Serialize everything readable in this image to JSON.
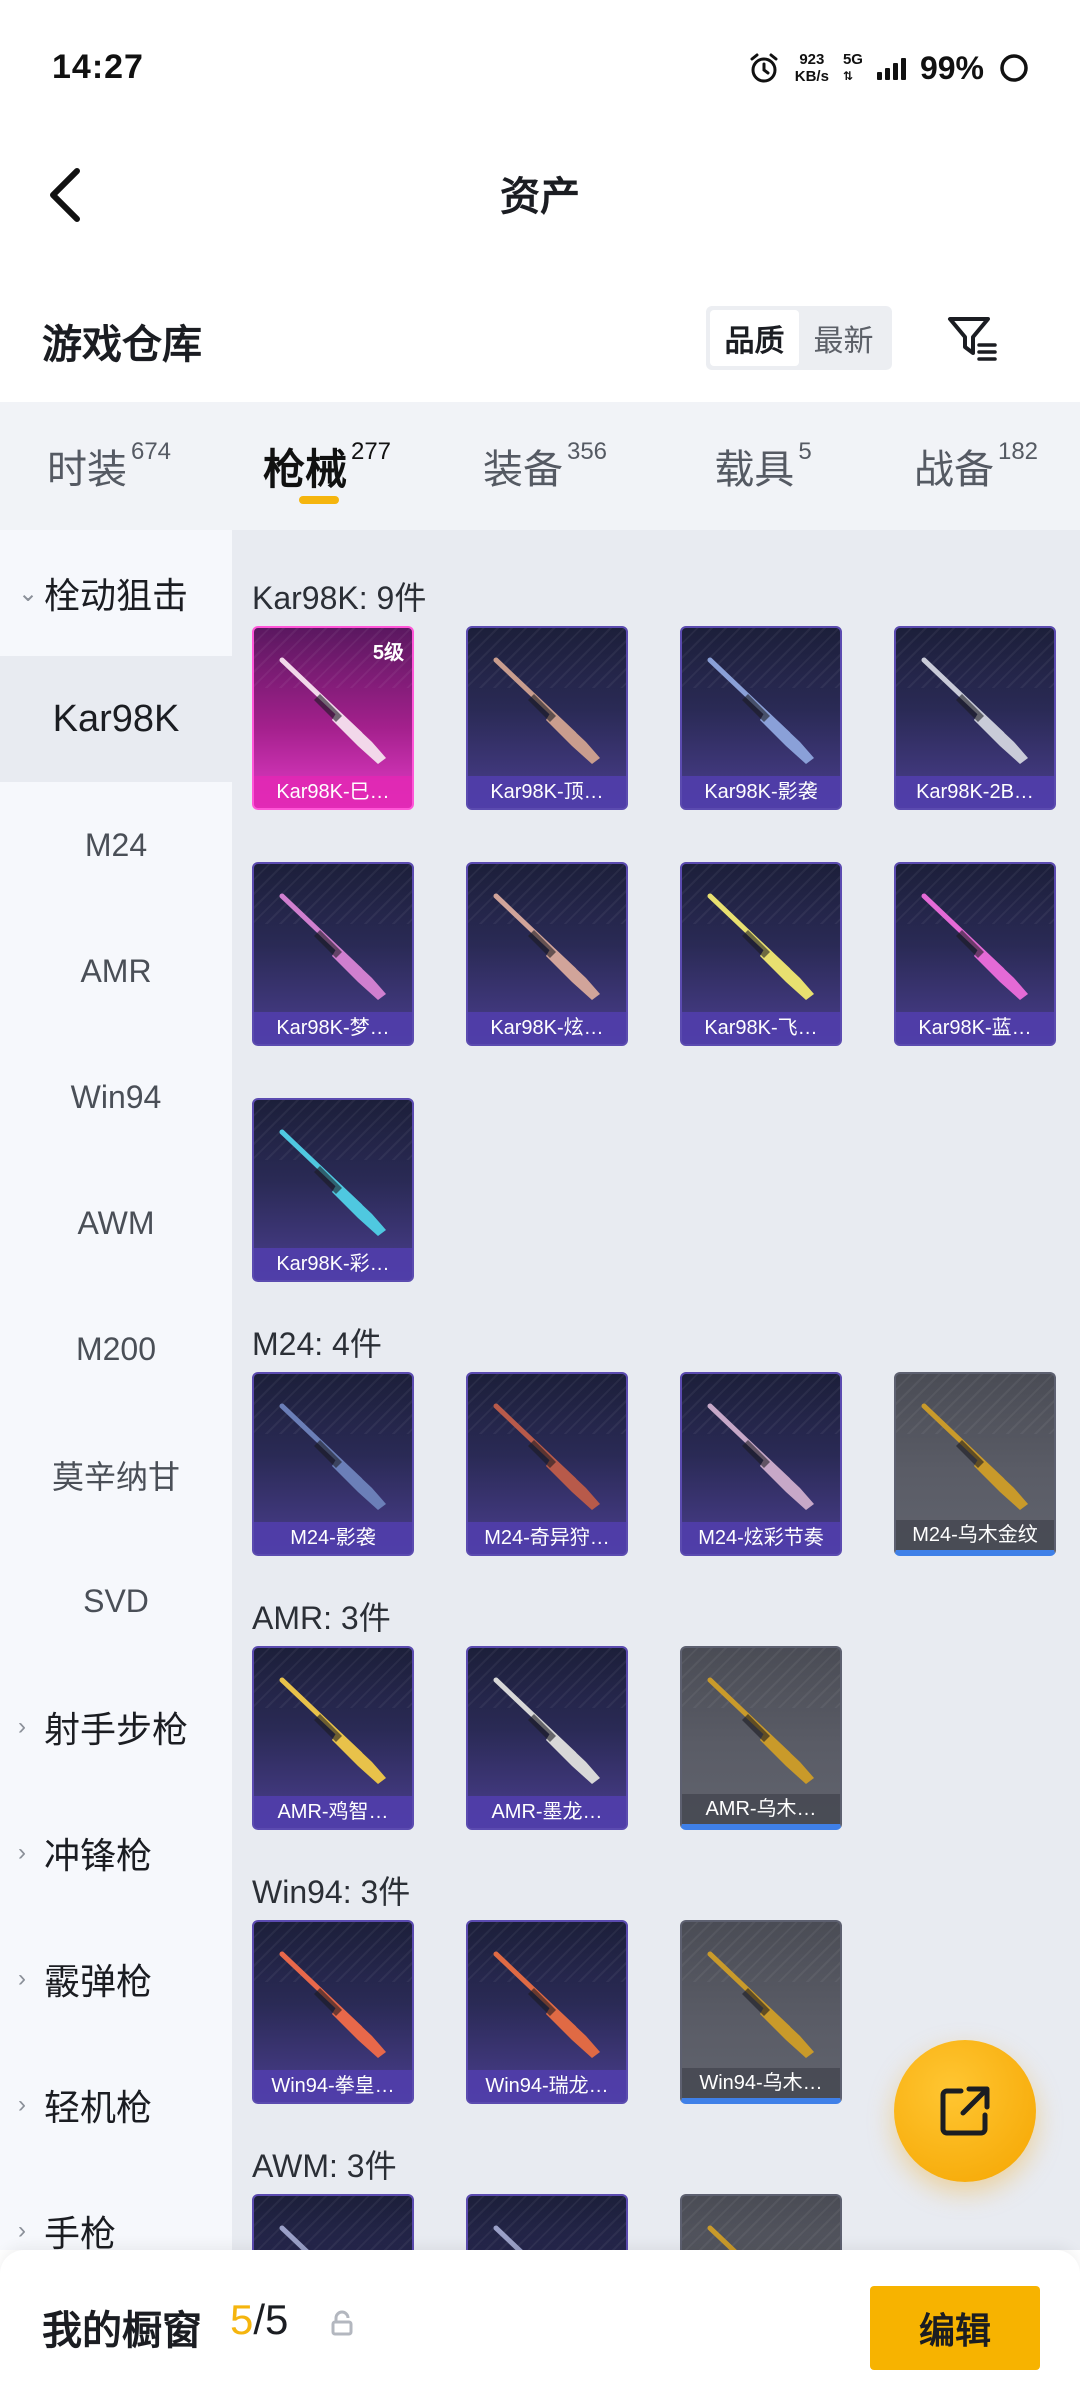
{
  "status_bar": {
    "time": "14:27",
    "speed_value": "923",
    "speed_unit": "KB/s",
    "network": "5G",
    "battery": "99%"
  },
  "header": {
    "title": "资产"
  },
  "warehouse": {
    "title": "游戏仓库",
    "sort_options": [
      "品质",
      "最新"
    ],
    "sort_selected": "品质"
  },
  "tabs": [
    {
      "label": "时装",
      "count": "674"
    },
    {
      "label": "枪械",
      "count": "277",
      "active": true
    },
    {
      "label": "装备",
      "count": "356"
    },
    {
      "label": "载具",
      "count": "5"
    },
    {
      "label": "战备",
      "count": "182"
    }
  ],
  "sidebar": {
    "groups": [
      {
        "label": "栓动狙击",
        "expanded": true,
        "items": [
          "Kar98K",
          "M24",
          "AMR",
          "Win94",
          "AWM",
          "M200",
          "莫辛纳甘",
          "SVD"
        ],
        "selected": "Kar98K"
      },
      {
        "label": "射手步枪"
      },
      {
        "label": "冲锋枪"
      },
      {
        "label": "霰弹枪"
      },
      {
        "label": "轻机枪"
      },
      {
        "label": "手枪"
      }
    ]
  },
  "sections": [
    {
      "title": "Kar98K: 9件",
      "items": [
        {
          "name": "Kar98K-巳…",
          "badge": "5级",
          "rarity": "legend",
          "gun": "#f2d8ea"
        },
        {
          "name": "Kar98K-顶…",
          "rarity": "epic",
          "gun": "#c99d8e"
        },
        {
          "name": "Kar98K-影袭",
          "rarity": "epic",
          "gun": "#8aa0d8"
        },
        {
          "name": "Kar98K-2B…",
          "rarity": "epic",
          "gun": "#c9cbd8"
        },
        {
          "name": "Kar98K-梦…",
          "rarity": "epic",
          "gun": "#d07fcf"
        },
        {
          "name": "Kar98K-炫…",
          "rarity": "epic",
          "gun": "#d1a49a"
        },
        {
          "name": "Kar98K-飞…",
          "rarity": "epic",
          "gun": "#e8e070"
        },
        {
          "name": "Kar98K-蓝…",
          "rarity": "epic",
          "gun": "#e46ad6"
        },
        {
          "name": "Kar98K-彩…",
          "rarity": "epic",
          "gun": "#4fc8e0"
        }
      ]
    },
    {
      "title": "M24: 4件",
      "items": [
        {
          "name": "M24-影袭",
          "rarity": "epic",
          "gun": "#6b7fb8"
        },
        {
          "name": "M24-奇异狩…",
          "rarity": "epic",
          "gun": "#b85a4a"
        },
        {
          "name": "M24-炫彩节奏",
          "rarity": "epic",
          "gun": "#c7a8c8"
        },
        {
          "name": "M24-乌木金纹",
          "rarity": "gray",
          "gun": "#c99a2a"
        }
      ]
    },
    {
      "title": "AMR: 3件",
      "items": [
        {
          "name": "AMR-鸡智…",
          "rarity": "epic",
          "gun": "#e8c24a"
        },
        {
          "name": "AMR-墨龙…",
          "rarity": "epic",
          "gun": "#d8d8d8"
        },
        {
          "name": "AMR-乌木…",
          "rarity": "gray",
          "gun": "#c99a2a"
        }
      ]
    },
    {
      "title": "Win94: 3件",
      "items": [
        {
          "name": "Win94-拳皇…",
          "rarity": "epic",
          "gun": "#e8684a"
        },
        {
          "name": "Win94-瑞龙…",
          "rarity": "epic",
          "gun": "#e06a44"
        },
        {
          "name": "Win94-乌木…",
          "rarity": "gray",
          "gun": "#c99a2a"
        }
      ]
    },
    {
      "title": "AWM: 3件",
      "items": [
        {
          "name": "",
          "rarity": "epic",
          "gun": "#9aa0c8"
        },
        {
          "name": "",
          "rarity": "epic",
          "gun": "#9aa0c8"
        },
        {
          "name": "",
          "rarity": "gray",
          "gun": "#c99a2a"
        }
      ]
    }
  ],
  "bottom_bar": {
    "title": "我的橱窗",
    "count_current": "5",
    "count_total": "/5",
    "edit_label": "编辑"
  },
  "colors": {
    "accent": "#f5b50e",
    "legend": "#e43cc8",
    "epic": "#5b4bb0"
  }
}
